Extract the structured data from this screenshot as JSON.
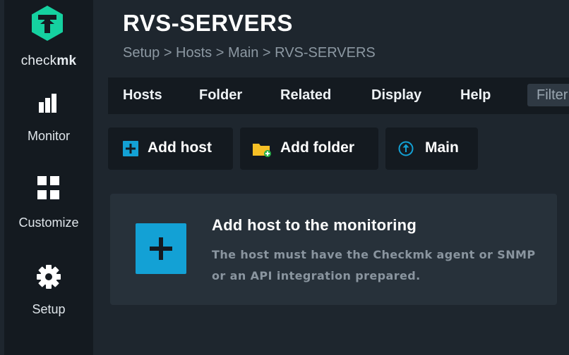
{
  "sidebar": {
    "brand_prefix": "check",
    "brand_suffix": "mk",
    "items": [
      {
        "label": "Monitor",
        "icon": "bar-chart-icon"
      },
      {
        "label": "Customize",
        "icon": "grid-icon"
      },
      {
        "label": "Setup",
        "icon": "gear-icon"
      }
    ]
  },
  "header": {
    "title": "RVS-SERVERS",
    "breadcrumb": "Setup > Hosts > Main > RVS-SERVERS"
  },
  "menubar": {
    "items": [
      "Hosts",
      "Folder",
      "Related",
      "Display",
      "Help"
    ],
    "filter_placeholder": "Filter"
  },
  "toolbar": {
    "add_host": "Add host",
    "add_folder": "Add folder",
    "main": "Main"
  },
  "card": {
    "title": "Add host to the monitoring",
    "description": "The host must have the Checkmk agent or SNMP or an API integration prepared."
  },
  "colors": {
    "background": "#1e262e",
    "sidebar": "#141a20",
    "accent_blue": "#13a1d5",
    "logo_green": "#15d1a0",
    "folder_yellow": "#f6c026"
  }
}
